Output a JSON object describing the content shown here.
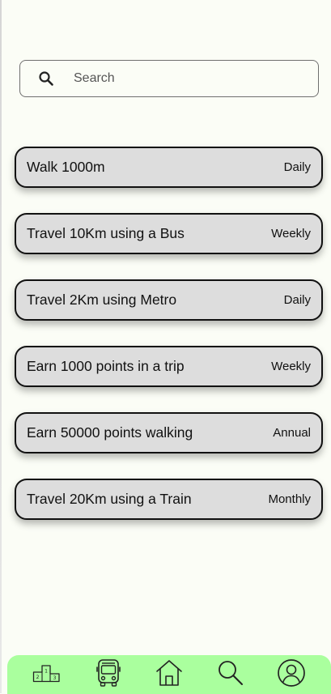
{
  "search": {
    "placeholder": "Search",
    "icon": "search-icon"
  },
  "challenges": [
    {
      "title": "Walk 1000m",
      "frequency": "Daily"
    },
    {
      "title": "Travel 10Km using a Bus",
      "frequency": "Weekly"
    },
    {
      "title": "Travel 2Km using Metro",
      "frequency": "Daily"
    },
    {
      "title": "Earn 1000 points in a trip",
      "frequency": "Weekly"
    },
    {
      "title": "Earn 50000 points walking",
      "frequency": "Annual"
    },
    {
      "title": "Travel 20Km using a Train",
      "frequency": "Monthly"
    }
  ],
  "bottom_nav": {
    "items": [
      {
        "icon": "podium-icon",
        "podium_labels": [
          "2",
          "1",
          "3"
        ]
      },
      {
        "icon": "bus-icon"
      },
      {
        "icon": "home-icon"
      },
      {
        "icon": "search-icon"
      },
      {
        "icon": "profile-icon"
      }
    ],
    "background": "#aaff9e"
  },
  "colors": {
    "page_background": "#fbfdf6",
    "card_background": "#dddddd",
    "card_border": "#111111"
  }
}
